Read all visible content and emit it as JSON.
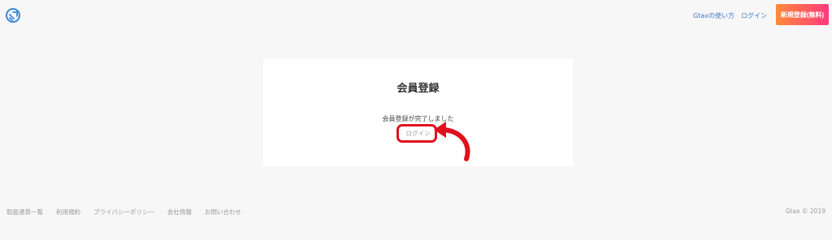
{
  "header": {
    "how_to_use": "Gtaxの使い方",
    "login": "ログイン",
    "signup": "新規登録(無料)"
  },
  "card": {
    "title": "会員登録",
    "message": "会員登録が完了しました",
    "login_link": "ログイン"
  },
  "footer": {
    "links": [
      "取扱通貨一覧",
      "利用規約",
      "プライバシーポリシー",
      "会社情報",
      "お問い合わせ"
    ],
    "copyright": "Gtax © 2019"
  },
  "colors": {
    "accent_link": "#3b7ac9",
    "signup_gradient_start": "#ff8a38",
    "signup_gradient_end": "#ff3a7c",
    "annotation_red": "#e0101e"
  }
}
